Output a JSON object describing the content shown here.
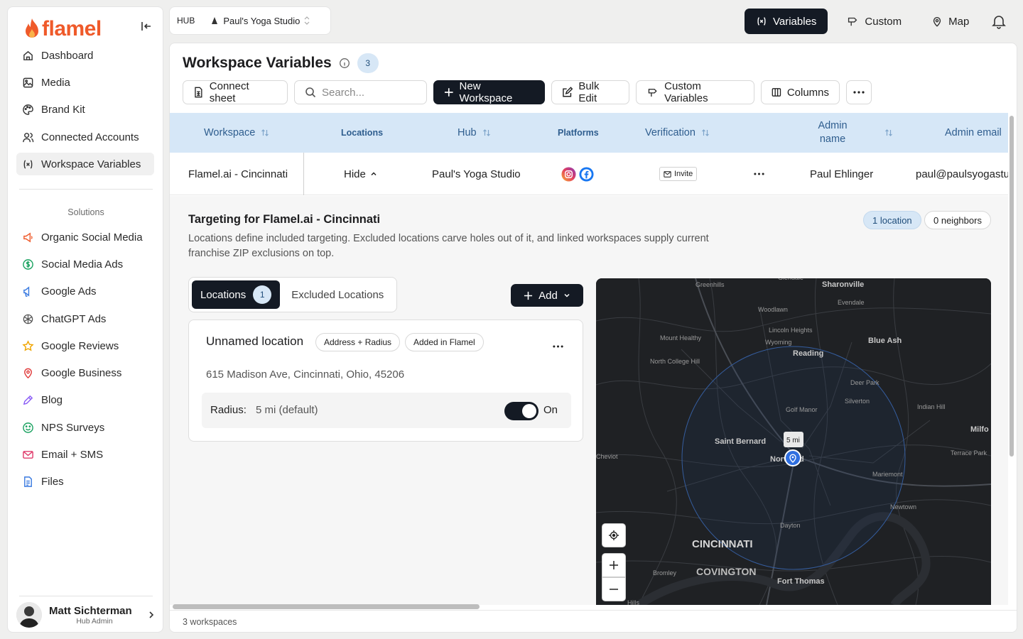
{
  "brand": {
    "name": "flamel",
    "accent": "#ef5a2a"
  },
  "sidebar": {
    "items": [
      {
        "label": "Dashboard",
        "icon": "home-icon"
      },
      {
        "label": "Media",
        "icon": "image-icon"
      },
      {
        "label": "Brand Kit",
        "icon": "palette-icon"
      },
      {
        "label": "Connected Accounts",
        "icon": "users-icon"
      },
      {
        "label": "Workspace Variables",
        "icon": "variable-icon",
        "active": true
      }
    ],
    "solutions_label": "Solutions",
    "solutions": [
      {
        "label": "Organic Social Media",
        "icon": "megaphone-icon",
        "color": "#ef5a2a"
      },
      {
        "label": "Social Media Ads",
        "icon": "dollar-icon",
        "color": "#1aa260"
      },
      {
        "label": "Google Ads",
        "icon": "ads-icon",
        "color": "#3b7be0"
      },
      {
        "label": "ChatGPT Ads",
        "icon": "openai-icon",
        "color": "#555555"
      },
      {
        "label": "Google Reviews",
        "icon": "star-icon",
        "color": "#f0a500"
      },
      {
        "label": "Google Business",
        "icon": "pin-icon",
        "color": "#e03b3b"
      },
      {
        "label": "Blog",
        "icon": "pen-icon",
        "color": "#8a5cf6"
      },
      {
        "label": "NPS Surveys",
        "icon": "smile-icon",
        "color": "#1aa260"
      },
      {
        "label": "Email + SMS",
        "icon": "mail-icon",
        "color": "#e03b6b"
      },
      {
        "label": "Files",
        "icon": "file-icon",
        "color": "#3b7be0"
      }
    ],
    "user": {
      "name": "Matt Sichterman",
      "role": "Hub Admin"
    }
  },
  "hubbar": {
    "label": "HUB",
    "studio": "Paul's Yoga Studio"
  },
  "topnav": {
    "variables": "Variables",
    "custom": "Custom",
    "map": "Map"
  },
  "page": {
    "title": "Workspace Variables",
    "count": "3",
    "toolbar": {
      "connect": "Connect sheet",
      "search_placeholder": "Search...",
      "new_workspace": "New Workspace",
      "bulk_edit": "Bulk Edit",
      "custom_variables": "Custom Variables",
      "columns": "Columns"
    },
    "table": {
      "headers": {
        "workspace": "Workspace",
        "locations": "Locations",
        "hub": "Hub",
        "platforms": "Platforms",
        "verification": "Verification",
        "admin_name": "Admin name",
        "admin_email": "Admin email"
      },
      "row": {
        "workspace": "Flamel.ai - Cincinnati",
        "locations": "Hide",
        "hub": "Paul's Yoga Studio",
        "verification": "Invite",
        "admin_name": "Paul Ehlinger",
        "admin_email": "paul@paulsyogastu"
      }
    },
    "targeting": {
      "title": "Targeting for Flamel.ai - Cincinnati",
      "description": "Locations define included targeting. Excluded locations carve holes out of it, and linked workspaces supply current franchise ZIP exclusions on top.",
      "location_pill": "1 location",
      "neighbors_pill": "0 neighbors",
      "tab_locations": "Locations",
      "tab_locations_count": "1",
      "tab_excluded": "Excluded Locations",
      "add": "Add",
      "location": {
        "name": "Unnamed location",
        "tag1": "Address + Radius",
        "tag2": "Added in Flamel",
        "address": "615 Madison Ave, Cincinnati, Ohio, 45206",
        "radius_label": "Radius:",
        "radius_value": "5 mi (default)",
        "toggle_label": "On"
      }
    },
    "map": {
      "radius_label": "5 mi",
      "places": [
        "Greenhills",
        "Sharonville",
        "Evendale",
        "Woodlawn",
        "Lincoln Heights",
        "Wyoming",
        "Mount Healthy",
        "Reading",
        "Blue Ash",
        "North College Hill",
        "Deer Park",
        "Silverton",
        "Golf Manor",
        "Indian Hill",
        "Milfo",
        "Saint Bernard",
        "Norwood",
        "Terrace Park",
        "Cheviot",
        "Mariemont",
        "Newtown",
        "Dayton",
        "CINCINNATI",
        "COVINGTON",
        "Bromley",
        "Fort Thomas",
        "Glendale",
        "Hills"
      ]
    },
    "footer": "3 workspaces"
  }
}
